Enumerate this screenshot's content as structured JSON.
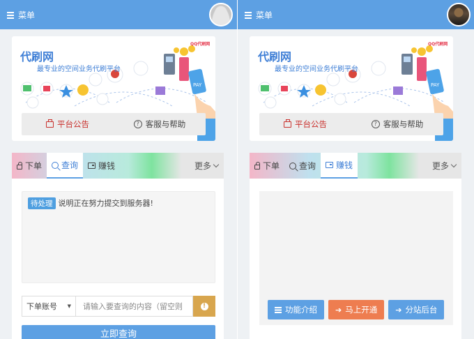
{
  "left": {
    "menu_label": "菜单",
    "banner": {
      "title": "代刷网",
      "subtitle": "最专业的空间业务代刷平台",
      "brand": "QQ代刷网"
    },
    "notice": {
      "announcement": "平台公告",
      "help": "客服与帮助"
    },
    "tabs": [
      {
        "label": "下单",
        "icon": "lock-icon"
      },
      {
        "label": "查询",
        "icon": "search-icon",
        "active": true
      },
      {
        "label": "赚钱",
        "icon": "wallet-icon"
      }
    ],
    "more_label": "更多",
    "status_badge": "待处理",
    "status_text": "说明正在努力提交到服务器!",
    "select_value": "下单账号",
    "query_placeholder": "请输入要查询的内容（留空则",
    "info_icon": "!",
    "submit_label": "立即查询"
  },
  "right": {
    "menu_label": "菜单",
    "banner": {
      "title": "代刷网",
      "subtitle": "最专业的空间业务代刷平台",
      "brand": "QQ代刷网"
    },
    "notice": {
      "announcement": "平台公告",
      "help": "客服与帮助"
    },
    "tabs": [
      {
        "label": "下单",
        "icon": "lock-icon"
      },
      {
        "label": "查询",
        "icon": "search-icon"
      },
      {
        "label": "赚钱",
        "icon": "wallet-icon",
        "active": true
      }
    ],
    "more_label": "更多",
    "buttons": [
      {
        "label": "功能介绍",
        "icon": "list-icon",
        "color": "#5da0e3"
      },
      {
        "label": "马上开通",
        "icon": "arrow-right-icon",
        "color": "#ee7d50"
      },
      {
        "label": "分站后台",
        "icon": "arrow-right-icon",
        "color": "#5da0e3"
      }
    ]
  },
  "colors": {
    "primary": "#5da0e3",
    "danger": "#c9302c",
    "warning": "#d8a64e",
    "orange": "#ee7d50"
  }
}
